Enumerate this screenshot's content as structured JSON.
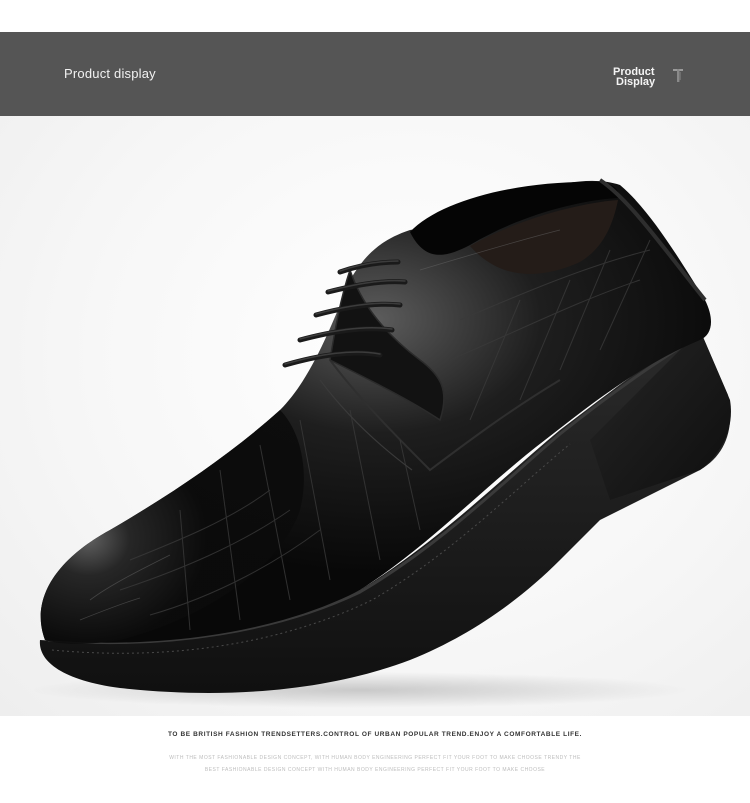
{
  "banner": {
    "title": "Product display",
    "logo_line1": "Product",
    "logo_line2": "Display",
    "logo_icon": "t-logo-icon",
    "background_color": "#555555"
  },
  "product": {
    "image": "black-leather-derby-shoe-icon",
    "leather_color": "#0d0d0d",
    "sole_color": "#1c1c1c"
  },
  "captions": {
    "main": "TO BE BRITISH FASHION TRENDSETTERS.CONTROL OF URBAN POPULAR TREND.ENJOY A COMFORTABLE LIFE.",
    "sub1": "WITH THE MOST FASHIONABLE DESIGN CONCEPT, WITH HUMAN BODY ENGINEERING PERFECT FIT YOUR FOOT TO MAKE CHOOSE TRENDY THE",
    "sub2": "BEST FASHIONABLE DESIGN CONCEPT WITH HUMAN BODY ENGINEERING PERFECT FIT YOUR FOOT TO MAKE CHOOSE"
  }
}
